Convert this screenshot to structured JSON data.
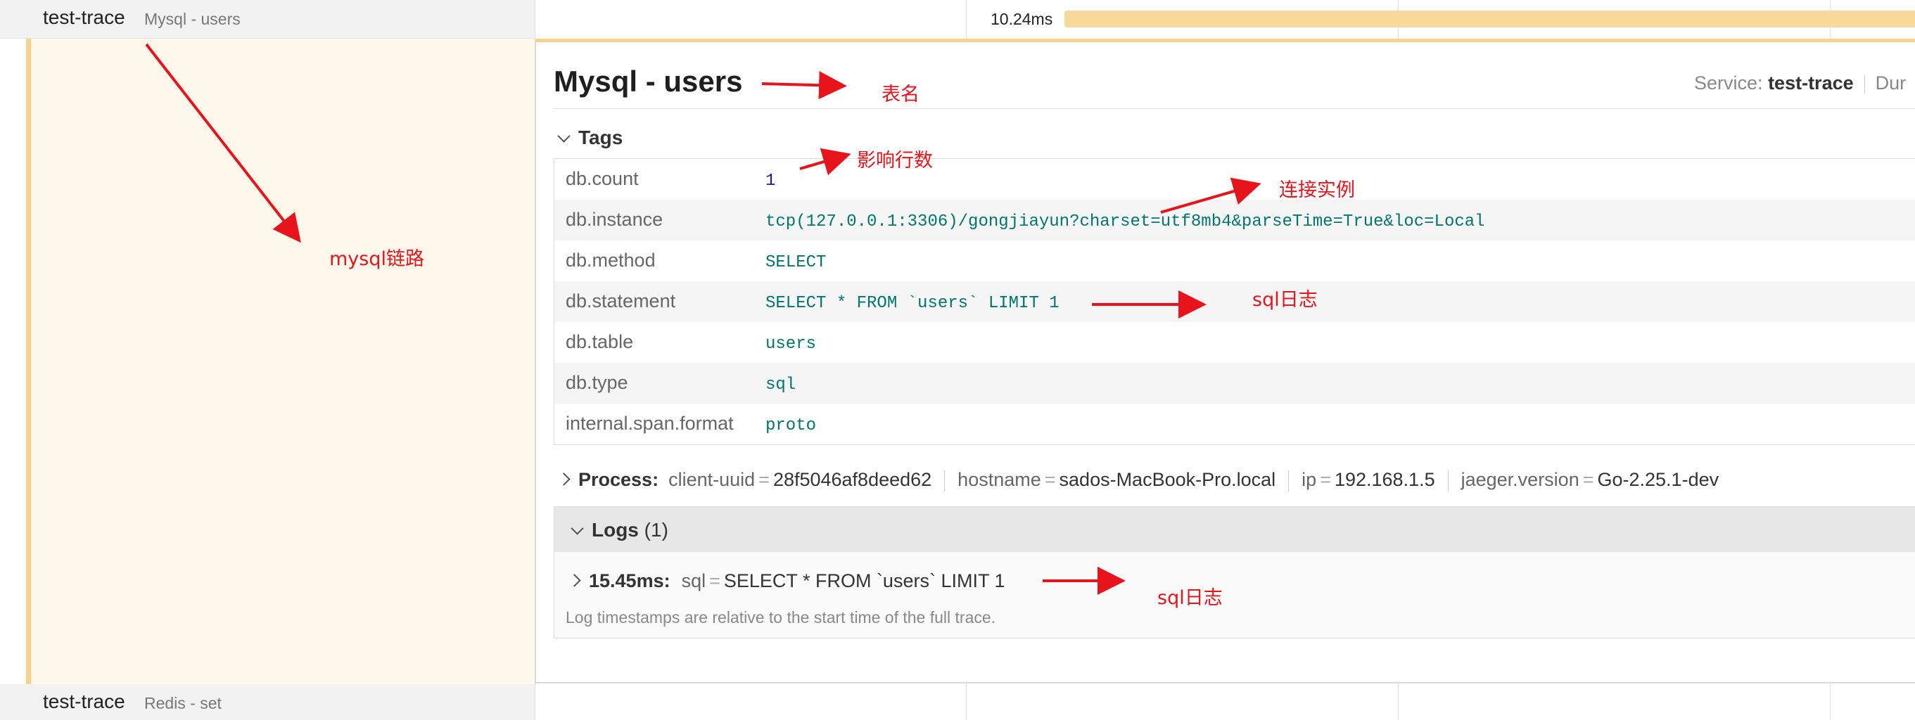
{
  "rows": {
    "top": {
      "service": "test-trace",
      "operation": "Mysql - users",
      "duration": "10.24ms"
    },
    "bottom": {
      "service": "test-trace",
      "operation": "Redis - set"
    }
  },
  "detail": {
    "title": "Mysql - users",
    "service_label": "Service:",
    "service_value": "test-trace",
    "duration_label_partial": "Dur"
  },
  "tags": {
    "heading": "Tags",
    "items": [
      {
        "key": "db.count",
        "value": "1"
      },
      {
        "key": "db.instance",
        "value": "tcp(127.0.0.1:3306)/gongjiayun?charset=utf8mb4&parseTime=True&loc=Local"
      },
      {
        "key": "db.method",
        "value": "SELECT"
      },
      {
        "key": "db.statement",
        "value": "SELECT * FROM `users` LIMIT 1"
      },
      {
        "key": "db.table",
        "value": "users"
      },
      {
        "key": "db.type",
        "value": "sql"
      },
      {
        "key": "internal.span.format",
        "value": "proto"
      }
    ]
  },
  "process": {
    "heading": "Process:",
    "items": [
      {
        "key": "client-uuid",
        "value": "28f5046af8deed62"
      },
      {
        "key": "hostname",
        "value": "sados-MacBook-Pro.local"
      },
      {
        "key": "ip",
        "value": "192.168.1.5"
      },
      {
        "key": "jaeger.version",
        "value": "Go-2.25.1-dev"
      }
    ]
  },
  "logs": {
    "heading": "Logs",
    "count": "(1)",
    "entry": {
      "time": "15.45ms:",
      "key": "sql",
      "value": "SELECT * FROM `users` LIMIT 1"
    },
    "note": "Log timestamps are relative to the start time of the full trace."
  },
  "annotations": {
    "table_name": "表名",
    "affected_rows": "影响行数",
    "connection_instance": "连接实例",
    "sql_log_1": "sql日志",
    "mysql_trace": "mysql链路",
    "sql_log_2": "sql日志"
  },
  "colors": {
    "bar": "#f9d999",
    "rail": "#f7d38f",
    "annotation": "#e8141c",
    "tag_value": "#00756f",
    "tag_number": "#1a1aa6"
  }
}
